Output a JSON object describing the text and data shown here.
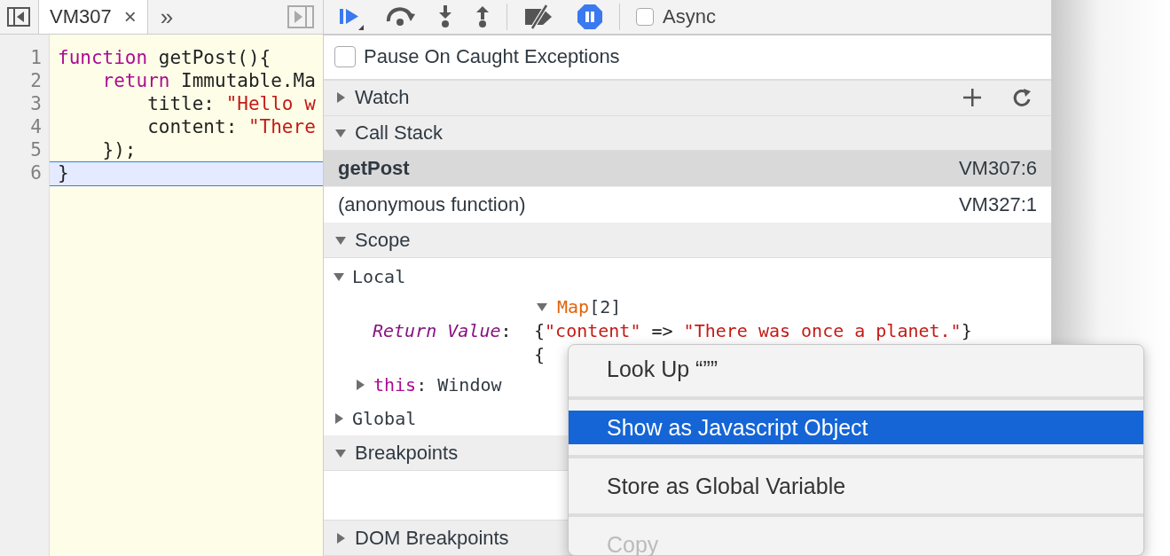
{
  "editor": {
    "tab": {
      "label": "VM307",
      "close": "×",
      "selected": true
    },
    "more": "»",
    "lines": [
      {
        "number": "1",
        "current": false,
        "tokens": [
          {
            "kind": "keyword",
            "text": "function"
          },
          {
            "kind": "plain",
            "text": " getPost(){"
          }
        ]
      },
      {
        "number": "2",
        "current": false,
        "tokens": [
          {
            "kind": "keyword",
            "text": "    return"
          },
          {
            "kind": "plain",
            "text": " Immutable.Ma"
          }
        ]
      },
      {
        "number": "3",
        "current": false,
        "tokens": [
          {
            "kind": "plain",
            "text": "        title: "
          },
          {
            "kind": "string",
            "text": "\"Hello w"
          }
        ]
      },
      {
        "number": "4",
        "current": false,
        "tokens": [
          {
            "kind": "plain",
            "text": "        content: "
          },
          {
            "kind": "string",
            "text": "\"There"
          }
        ]
      },
      {
        "number": "5",
        "current": false,
        "tokens": [
          {
            "kind": "plain",
            "text": "    });"
          }
        ]
      },
      {
        "number": "6",
        "current": true,
        "tokens": [
          {
            "kind": "plain",
            "text": "}"
          }
        ]
      }
    ]
  },
  "toolbar": {
    "async": {
      "label": "Async",
      "checked": false
    }
  },
  "pause_on_caught": {
    "label": "Pause On Caught Exceptions",
    "checked": false
  },
  "watch": {
    "title": "Watch",
    "expanded": false
  },
  "call_stack": {
    "title": "Call Stack",
    "expanded": true,
    "frames": [
      {
        "name": "getPost",
        "location": "VM307:6",
        "selected": true
      },
      {
        "name": "(anonymous function)",
        "location": "VM327:1",
        "selected": false
      }
    ]
  },
  "scope": {
    "title": "Scope",
    "expanded": true,
    "groups": [
      {
        "name": "Local",
        "expanded": true,
        "children": [
          {
            "kind": "return-value",
            "name": "Return Value",
            "separator": ":",
            "type": "Map",
            "count": "[2]",
            "expanded": true,
            "entries": [
              [
                {
                  "kind": "punct",
                  "text": "{"
                },
                {
                  "kind": "string",
                  "text": "\"content\""
                },
                {
                  "kind": "punct",
                  "text": " => "
                },
                {
                  "kind": "string",
                  "text": "\"There was once a planet.\""
                },
                {
                  "kind": "punct",
                  "text": "}"
                }
              ],
              [
                {
                  "kind": "punct",
                  "text": "{"
                }
              ]
            ]
          },
          {
            "kind": "property",
            "name": "this",
            "separator": ":",
            "value": "Window",
            "expanded": false
          }
        ]
      },
      {
        "name": "Global",
        "expanded": false
      }
    ]
  },
  "breakpoints": {
    "title": "Breakpoints",
    "expanded": true
  },
  "dom_breakpoints": {
    "title": "DOM Breakpoints",
    "expanded": false
  },
  "context_menu": {
    "items": [
      {
        "label": "Look Up “””",
        "selected": false,
        "disabled": false
      },
      {
        "label": "Show as Javascript Object",
        "selected": true,
        "disabled": false
      },
      {
        "label": "Store as Global Variable",
        "selected": false,
        "disabled": false
      },
      {
        "label": "Copy",
        "selected": false,
        "disabled": true
      }
    ]
  }
}
